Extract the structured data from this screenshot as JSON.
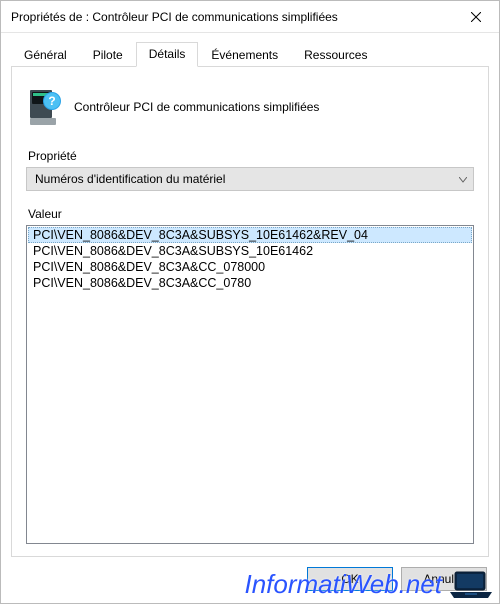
{
  "window": {
    "title": "Propriétés de : Contrôleur PCI de communications simplifiées"
  },
  "tabs": {
    "general": "Général",
    "driver": "Pilote",
    "details": "Détails",
    "events": "Événements",
    "resources": "Ressources",
    "active": "details"
  },
  "device": {
    "name": "Contrôleur PCI de communications simplifiées"
  },
  "details": {
    "property_label": "Propriété",
    "property_selected": "Numéros d'identification du matériel",
    "value_label": "Valeur",
    "values": [
      "PCI\\VEN_8086&DEV_8C3A&SUBSYS_10E61462&REV_04",
      "PCI\\VEN_8086&DEV_8C3A&SUBSYS_10E61462",
      "PCI\\VEN_8086&DEV_8C3A&CC_078000",
      "PCI\\VEN_8086&DEV_8C3A&CC_0780"
    ],
    "selected_index": 0
  },
  "buttons": {
    "ok": "OK",
    "cancel": "Annuler"
  },
  "watermark": "InformatiWeb.net"
}
